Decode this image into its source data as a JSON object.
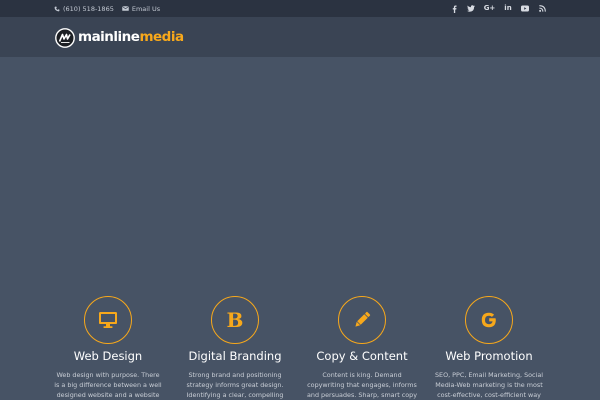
{
  "topbar": {
    "phone": "(610) 518-1865",
    "email_label": "Email Us",
    "social": [
      {
        "icon": "facebook-icon",
        "glyph": "f"
      },
      {
        "icon": "twitter-icon",
        "glyph": "t"
      },
      {
        "icon": "google-plus-icon",
        "glyph": "G+"
      },
      {
        "icon": "linkedin-icon",
        "glyph": "in"
      },
      {
        "icon": "youtube-icon",
        "glyph": "▶"
      },
      {
        "icon": "rss-icon",
        "glyph": "rss"
      }
    ]
  },
  "brand": {
    "name_part1": "mainline",
    "name_part2": "media",
    "accent_color": "#f7a81b"
  },
  "services": [
    {
      "icon": "monitor-icon",
      "title": "Web Design",
      "desc": "Web design with purpose. There is a big difference between a well designed website and a website"
    },
    {
      "icon": "letter-b-icon",
      "title": "Digital Branding",
      "desc": "Strong brand and positioning strategy informs great design. Identifying a clear, compelling brand"
    },
    {
      "icon": "pencil-icon",
      "title": "Copy & Content",
      "desc": "Content is king. Demand copywriting that engages, informs and persuades. Sharp, smart copy"
    },
    {
      "icon": "google-g-icon",
      "title": "Web Promotion",
      "desc": "SEO, PPC, Email Marketing, Social Media-Web marketing is the most cost-effective, cost-efficient way to"
    }
  ],
  "colors": {
    "topbar_bg": "#2b3341",
    "header_bg": "#3a4454",
    "hero_bg": "#475365",
    "accent": "#f7a81b"
  }
}
